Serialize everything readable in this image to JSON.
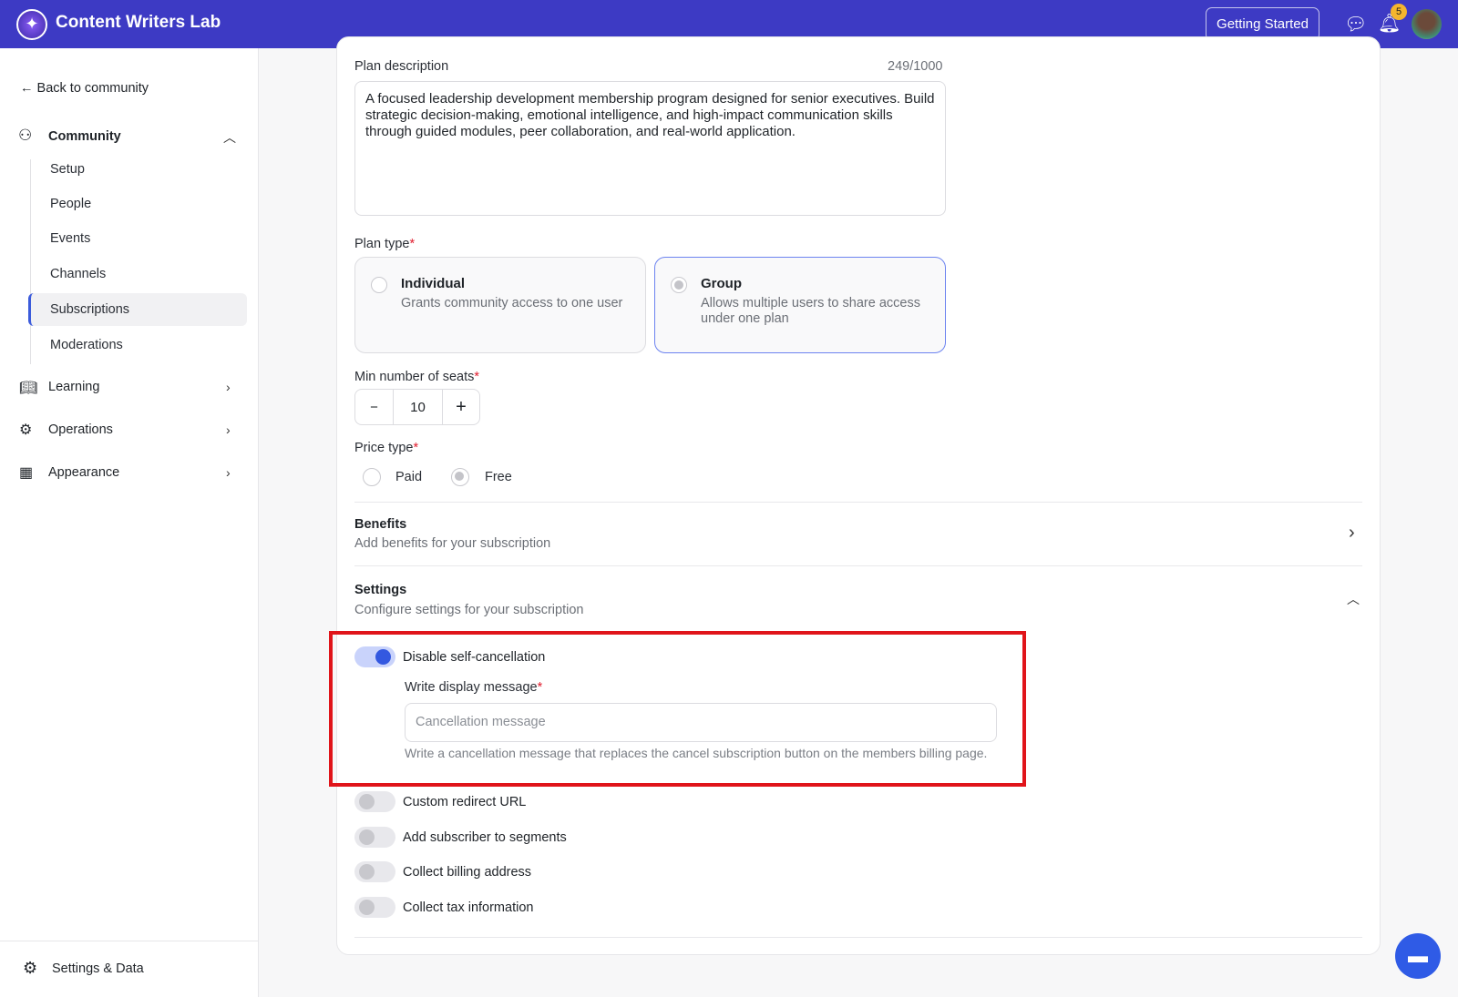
{
  "header": {
    "title": "Content Writers Lab",
    "getting_started": "Getting Started",
    "notification_count": "5"
  },
  "sidebar": {
    "back": "Back to community",
    "community": "Community",
    "sub_items": [
      "Setup",
      "People",
      "Events",
      "Channels",
      "Subscriptions",
      "Moderations"
    ],
    "active": "Subscriptions",
    "learning": "Learning",
    "operations": "Operations",
    "appearance": "Appearance",
    "settings": "Settings & Data"
  },
  "form": {
    "desc_label": "Plan description",
    "desc_count": "249/1000",
    "desc_value": "A focused leadership development membership program designed for senior executives. Build strategic decision-making, emotional intelligence, and high-impact communication skills through guided modules, peer collaboration, and real-world application.",
    "plan_type_label": "Plan type",
    "req": "*",
    "plan_types": [
      {
        "title": "Individual",
        "desc": "Grants community access to one user"
      },
      {
        "title": "Group",
        "desc": "Allows multiple users to share access under one plan"
      }
    ],
    "seats_label": "Min number of seats",
    "seats_value": "10",
    "minus": "−",
    "plus": "+",
    "price_type_label": "Price type",
    "price_paid": "Paid",
    "price_free": "Free",
    "benefits_title": "Benefits",
    "benefits_sub": "Add benefits for your subscription",
    "settings_title": "Settings",
    "settings_sub": "Configure settings for your subscription",
    "toggles": [
      "Disable self-cancellation",
      "Custom redirect URL",
      "Add subscriber to segments",
      "Collect billing address",
      "Collect tax information"
    ],
    "msg_label": "Write display message",
    "msg_placeholder": "Cancellation message",
    "msg_help": "Write a cancellation message that replaces the cancel subscription button on the members billing page."
  }
}
